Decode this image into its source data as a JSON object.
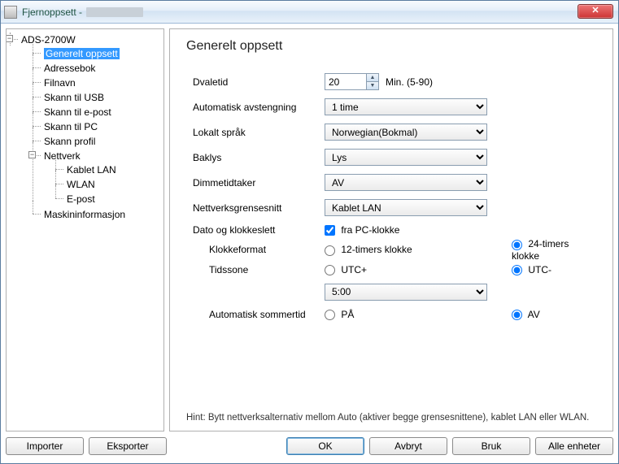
{
  "window": {
    "title_prefix": "Fjernoppsett -",
    "close_glyph": "✕"
  },
  "tree": {
    "root": "ADS-2700W",
    "items": [
      "Generelt oppsett",
      "Adressebok",
      "Filnavn",
      "Skann til USB",
      "Skann til e-post",
      "Skann til PC",
      "Skann profil"
    ],
    "network_label": "Nettverk",
    "network_items": [
      "Kablet LAN",
      "WLAN",
      "E-post"
    ],
    "machine_info": "Maskininformasjon"
  },
  "main": {
    "heading": "Generelt oppsett",
    "labels": {
      "sleep": "Dvaletid",
      "sleep_unit": "Min. (5-90)",
      "auto_off": "Automatisk avstengning",
      "language": "Lokalt språk",
      "backlight": "Baklys",
      "dim_timer": "Dimmetidtaker",
      "net_iface": "Nettverksgrensesnitt",
      "datetime": "Dato og klokkeslett",
      "from_pc": "fra PC-klokke",
      "clock_format": "Klokkeformat",
      "clock_12": "12-timers klokke",
      "clock_24": "24-timers klokke",
      "timezone": "Tidssone",
      "utc_plus": "UTC+",
      "utc_minus": "UTC-",
      "dst": "Automatisk sommertid",
      "on": "PÅ",
      "off": "AV"
    },
    "values": {
      "sleep": "20",
      "auto_off": "1 time",
      "language": "Norwegian(Bokmal)",
      "backlight": "Lys",
      "dim_timer": "AV",
      "net_iface": "Kablet LAN",
      "from_pc_checked": true,
      "clock_format": "24",
      "utc_sign": "-",
      "tz_offset": "5:00",
      "dst": "AV"
    },
    "hint": "Hint: Bytt nettverksalternativ mellom Auto (aktiver begge grensesnittene), kablet LAN eller WLAN."
  },
  "buttons": {
    "import": "Importer",
    "export": "Eksporter",
    "ok": "OK",
    "cancel": "Avbryt",
    "apply": "Bruk",
    "all_units": "Alle enheter"
  }
}
